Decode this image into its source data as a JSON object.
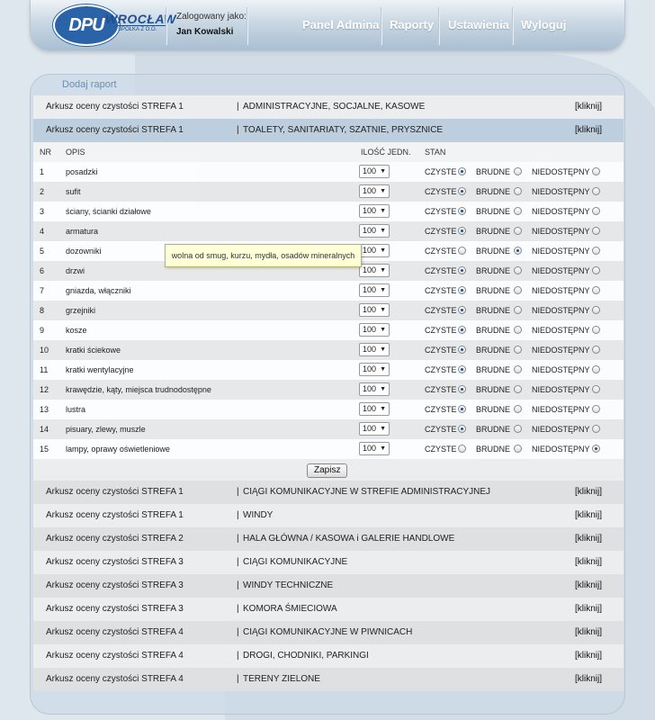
{
  "header": {
    "logo_text": "DPU",
    "logo_city": "WROCŁAW",
    "logo_sub": "SPÓŁKA Z O.O.",
    "login_label": "Zalogowany jako:",
    "login_user": "Jan Kowalski",
    "nav": [
      "Panel Admina",
      "Raporty",
      "Ustawienia",
      "Wyloguj"
    ]
  },
  "add_report_label": "Dodaj raport",
  "reports_top": [
    {
      "name": "Arkusz oceny czystości STREFA 1",
      "category": "ADMINISTRACYJNE, SOCJALNE, KASOWE",
      "link": "[kliknij]"
    },
    {
      "name": "Arkusz oceny czystości STREFA 1",
      "category": "TOALETY, SANITARIATY, SZATNIE, PRYSZNICE",
      "link": "[kliknij]"
    }
  ],
  "table_headers": {
    "nr": "NR",
    "desc": "OPIS",
    "qty": "ILOŚĆ JEDN.",
    "stan": "STAN"
  },
  "options": {
    "clean": "CZYSTE",
    "dirty": "BRUDNE",
    "na": "NIEDOSTĘPNY"
  },
  "items": [
    {
      "nr": "1",
      "desc": "posadzki",
      "qty": "100",
      "state": "clean"
    },
    {
      "nr": "2",
      "desc": "sufit",
      "qty": "100",
      "state": "clean"
    },
    {
      "nr": "3",
      "desc": "ściany, ścianki działowe",
      "qty": "100",
      "state": "clean"
    },
    {
      "nr": "4",
      "desc": "armatura",
      "qty": "100",
      "state": "clean"
    },
    {
      "nr": "5",
      "desc": "dozowniki",
      "qty": "100",
      "state": "dirty"
    },
    {
      "nr": "6",
      "desc": "drzwi",
      "qty": "100",
      "state": "clean"
    },
    {
      "nr": "7",
      "desc": "gniazda, włączniki",
      "qty": "100",
      "state": "clean"
    },
    {
      "nr": "8",
      "desc": "grzejniki",
      "qty": "100",
      "state": "clean"
    },
    {
      "nr": "9",
      "desc": "kosze",
      "qty": "100",
      "state": "clean"
    },
    {
      "nr": "10",
      "desc": "kratki ściekowe",
      "qty": "100",
      "state": "clean"
    },
    {
      "nr": "11",
      "desc": "kratki wentylacyjne",
      "qty": "100",
      "state": "clean"
    },
    {
      "nr": "12",
      "desc": "krawędzie, kąty, miejsca trudnodostępne",
      "qty": "100",
      "state": "clean"
    },
    {
      "nr": "13",
      "desc": "lustra",
      "qty": "100",
      "state": "clean"
    },
    {
      "nr": "14",
      "desc": "pisuary, zlewy, muszle",
      "qty": "100",
      "state": "clean"
    },
    {
      "nr": "15",
      "desc": "lampy, oprawy oświetleniowe",
      "qty": "100",
      "state": "na"
    }
  ],
  "save_label": "Zapisz",
  "tooltip": "wolna od smug, kurzu, mydła, osadów mineralnych",
  "reports_bottom": [
    {
      "name": "Arkusz oceny czystości STREFA 1",
      "category": "CIĄGI KOMUNIKACYJNE W STREFIE ADMINISTRACYJNEJ",
      "link": "[kliknij]"
    },
    {
      "name": "Arkusz oceny czystości STREFA 1",
      "category": "WINDY",
      "link": "[kliknij]"
    },
    {
      "name": "Arkusz oceny czystości STREFA 2",
      "category": "HALA GŁÓWNA / KASOWA i GALERIE HANDLOWE",
      "link": "[kliknij]"
    },
    {
      "name": "Arkusz oceny czystości STREFA 3",
      "category": "CIĄGI KOMUNIKACYJNE",
      "link": "[kliknij]"
    },
    {
      "name": "Arkusz oceny czystości STREFA 3",
      "category": "WINDY TECHNICZNE",
      "link": "[kliknij]"
    },
    {
      "name": "Arkusz oceny czystości STREFA 3",
      "category": "KOMORA ŚMIECIOWA",
      "link": "[kliknij]"
    },
    {
      "name": "Arkusz oceny czystości STREFA 4",
      "category": "CIĄGI KOMUNIKACYJNE W PIWNICACH",
      "link": "[kliknij]"
    },
    {
      "name": "Arkusz oceny czystości STREFA 4",
      "category": "DROGI, CHODNIKI, PARKINGI",
      "link": "[kliknij]"
    },
    {
      "name": "Arkusz oceny czystości STREFA 4",
      "category": "TERENY ZIELONE",
      "link": "[kliknij]"
    }
  ],
  "colors": {
    "brand": "#2a63a8",
    "active_row": "#bccede",
    "tooltip_bg": "#ffffd8"
  }
}
